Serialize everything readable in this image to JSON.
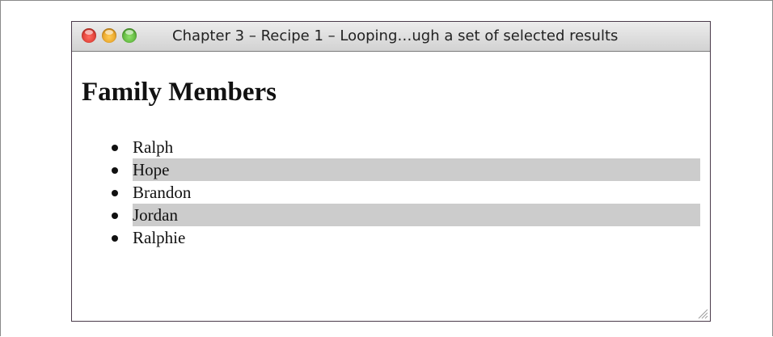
{
  "window": {
    "title": "Chapter 3 – Recipe 1 – Looping…ugh a set of selected results"
  },
  "page": {
    "heading": "Family Members",
    "members": [
      {
        "name": "Ralph",
        "highlighted": false
      },
      {
        "name": "Hope",
        "highlighted": true
      },
      {
        "name": "Brandon",
        "highlighted": false
      },
      {
        "name": "Jordan",
        "highlighted": true
      },
      {
        "name": "Ralphie",
        "highlighted": false
      }
    ]
  },
  "colors": {
    "highlight": "#cccccc",
    "close": "#e0443a",
    "minimize": "#f2a530",
    "zoom": "#5ec23e"
  },
  "icons": [
    "close-button-icon",
    "minimize-button-icon",
    "zoom-button-icon",
    "resize-grip-icon"
  ]
}
